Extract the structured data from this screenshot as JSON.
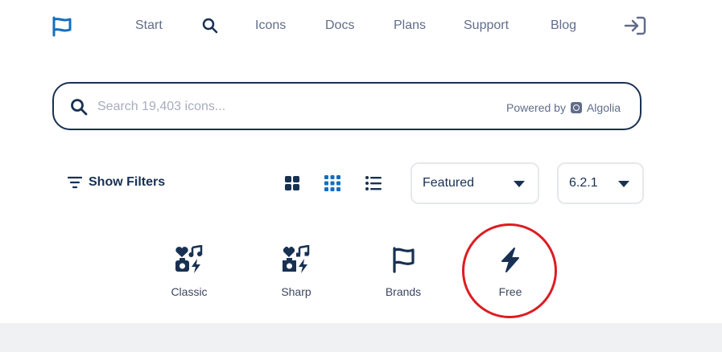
{
  "nav": {
    "links": [
      "Start",
      "Icons",
      "Docs",
      "Plans",
      "Support",
      "Blog"
    ]
  },
  "search": {
    "placeholder": "Search 19,403 icons...",
    "powered_by": "Powered by",
    "provider": "Algolia"
  },
  "toolbar": {
    "filters_label": "Show Filters",
    "sort_value": "Featured",
    "version_value": "6.2.1"
  },
  "families": [
    "Classic",
    "Sharp",
    "Brands",
    "Free"
  ],
  "colors": {
    "text": "#183153",
    "accent": "#146ebe",
    "highlight": "#dd1c22"
  }
}
